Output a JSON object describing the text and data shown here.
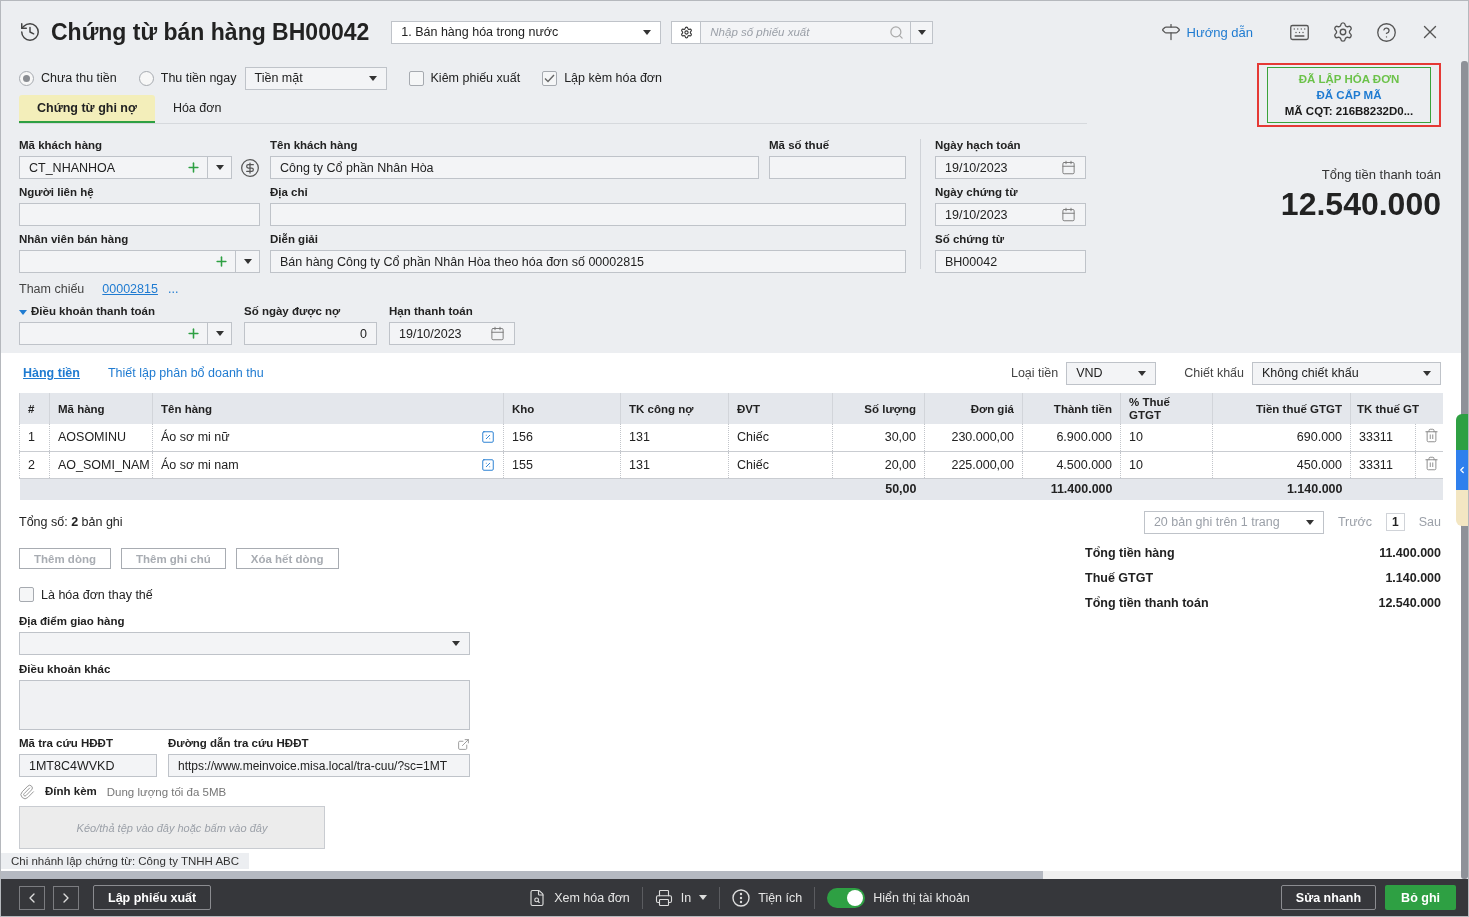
{
  "header": {
    "title": "Chứng từ bán hàng BH00042",
    "voucher_type": "1. Bán hàng hóa trong nước",
    "search_placeholder": "Nhập số phiếu xuất",
    "guide_link": "Hướng dẫn"
  },
  "status_badge": {
    "lines": [
      {
        "text": "ĐÃ LẬP HÓA ĐƠN",
        "color": "#6cc24a"
      },
      {
        "text": "ĐÃ CẤP MÃ",
        "color": "#1f7bd1"
      },
      {
        "text": "MÃ CQT: 216B8232D0...",
        "color": "#1a1a1a"
      }
    ]
  },
  "payment": {
    "options": [
      {
        "label": "Chưa thu tiền",
        "selected": true
      },
      {
        "label": "Thu tiền ngay",
        "selected": false
      }
    ],
    "method": "Tiền mặt",
    "checkboxes": [
      {
        "label": "Kiêm phiếu xuất",
        "checked": false
      },
      {
        "label": "Lập kèm hóa đơn",
        "checked": true
      }
    ]
  },
  "tabs": [
    {
      "label": "Chứng từ ghi nợ",
      "selected": true
    },
    {
      "label": "Hóa đơn",
      "selected": false
    }
  ],
  "form": {
    "customer_code": {
      "label": "Mã khách hàng",
      "value": "CT_NHANHOA"
    },
    "customer_name": {
      "label": "Tên khách hàng",
      "value": "Công ty Cổ phần Nhân Hòa"
    },
    "tax_code": {
      "label": "Mã số thuế"
    },
    "contact": {
      "label": "Người liên hệ"
    },
    "address": {
      "label": "Địa chỉ"
    },
    "salesperson": {
      "label": "Nhân viên bán hàng"
    },
    "description": {
      "label": "Diễn giải",
      "value": "Bán hàng Công ty Cổ phần Nhân Hòa theo hóa đơn số 00002815"
    },
    "reference": {
      "label": "Tham chiếu",
      "link": "00002815",
      "more": "..."
    },
    "payment_terms": {
      "label": "Điều khoản thanh toán"
    },
    "debt_days": {
      "label": "Số ngày được nợ",
      "value": "0"
    },
    "due_date": {
      "label": "Hạn thanh toán",
      "value": "19/10/2023"
    }
  },
  "dates": {
    "posting_date": {
      "label": "Ngày hạch toán",
      "value": "19/10/2023"
    },
    "voucher_date": {
      "label": "Ngày chứng từ",
      "value": "19/10/2023"
    },
    "voucher_number": {
      "label": "Số chứng từ",
      "value": "BH00042"
    }
  },
  "total": {
    "label": "Tổng tiền thanh toán",
    "amount": "12.540.000"
  },
  "detail_tabs": [
    {
      "label": "Hàng tiền",
      "selected": true
    },
    {
      "label": "Thiết lập phân bổ doanh thu",
      "selected": false
    }
  ],
  "currency": {
    "label": "Loại tiền",
    "value": "VND"
  },
  "discount": {
    "label": "Chiết khấu",
    "value": "Không chiết khấu"
  },
  "table": {
    "columns": [
      "#",
      "Mã hàng",
      "Tên hàng",
      "Kho",
      "TK công nợ",
      "ĐVT",
      "Số lượng",
      "Đơn giá",
      "Thành tiền",
      "% Thuế GTGT",
      "Tiền thuế GTGT",
      "TK thuế GT"
    ],
    "rows": [
      {
        "cells": [
          "1",
          "AOSOMINU",
          "Áo sơ mi nữ",
          "156",
          "131",
          "Chiếc",
          "30,00",
          "230.000,00",
          "6.900.000",
          "10",
          "690.000",
          "33311"
        ]
      },
      {
        "cells": [
          "2",
          "AO_SOMI_NAM",
          "Áo sơ mi nam",
          "155",
          "131",
          "Chiếc",
          "20,00",
          "225.000,00",
          "4.500.000",
          "10",
          "450.000",
          "33311"
        ]
      }
    ],
    "totals": {
      "quantity": "50,00",
      "amount": "11.400.000",
      "vat": "1.140.000"
    }
  },
  "record_count": "Tổng số: **2** bản ghi",
  "pagination": {
    "page_size": "20 bản ghi trên 1 trang",
    "previous": "Trước",
    "page": "1",
    "next": "Sau"
  },
  "row_buttons": [
    {
      "label": "Thêm dòng",
      "disabled": true
    },
    {
      "label": "Thêm ghi chú",
      "disabled": true
    },
    {
      "label": "Xóa hết dòng",
      "disabled": true
    }
  ],
  "replacement_invoice": {
    "label": "Là hóa đơn thay thế",
    "checked": false
  },
  "summary": [
    {
      "label": "Tổng tiền hàng",
      "value": "11.400.000"
    },
    {
      "label": "Thuế GTGT",
      "value": "1.140.000"
    },
    {
      "label": "Tổng tiền thanh toán",
      "value": "12.540.000"
    }
  ],
  "delivery_place": {
    "label": "Địa điểm giao hàng"
  },
  "other_terms": {
    "label": "Điều khoản khác"
  },
  "lookup_code": {
    "label": "Mã tra cứu HĐĐT",
    "value": "1MT8C4WVKD"
  },
  "lookup_url": {
    "label": "Đường dẫn tra cứu HĐĐT",
    "value": "https://www.meinvoice.misa.local/tra-cuu/?sc=1MT"
  },
  "attachment": {
    "label": "Đính kèm",
    "hint": "Dung lượng tối đa 5MB",
    "dropzone": "Kéo/thả tệp vào đây hoặc bấm vào đây"
  },
  "branch_note": "Chi nhánh lập chứng từ: Công ty TNHH ABC",
  "footer": {
    "create_issue": "Lập phiếu xuất",
    "view_invoice": "Xem hóa đơn",
    "print": "In",
    "utilities": "Tiện ích",
    "show_accounts": {
      "label": "Hiển thị tài khoản",
      "on": true
    },
    "quick_edit": "Sửa nhanh",
    "unpost": "Bỏ ghi"
  }
}
